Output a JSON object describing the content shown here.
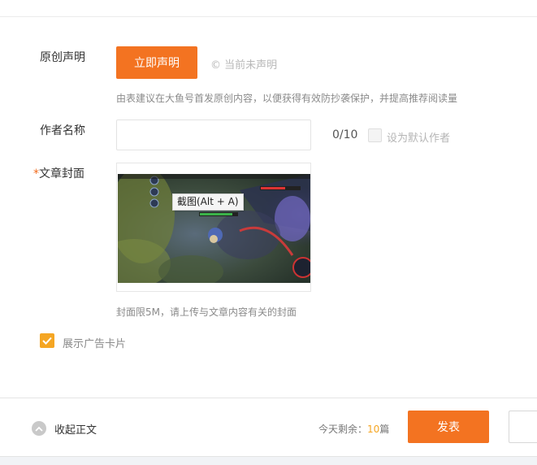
{
  "form": {
    "original_label": "原创声明",
    "declare_button": "立即声明",
    "declare_status": "© 当前未声明",
    "original_hint": "由表建议在大鱼号首发原创内容，以便获得有效防抄袭保护，并提高推荐阅读量",
    "author_label": "作者名称",
    "author_value": "",
    "author_counter": "0/10",
    "default_author_label": "设为默认作者",
    "cover_required_mark": "*",
    "cover_label": "文章封面",
    "cover_tooltip": "截图(Alt + A)",
    "cover_hint": "封面限5M，请上传与文章内容有关的封面",
    "ad_card_label": "展示广告卡片",
    "ad_card_checked": true
  },
  "footer": {
    "collapse_label": "收起正文",
    "quota_prefix": "今天剩余：",
    "quota_count": "10",
    "quota_suffix": "篇",
    "publish_button": "发表"
  },
  "colors": {
    "accent": "#f37321",
    "checkbox": "#f5a623"
  }
}
